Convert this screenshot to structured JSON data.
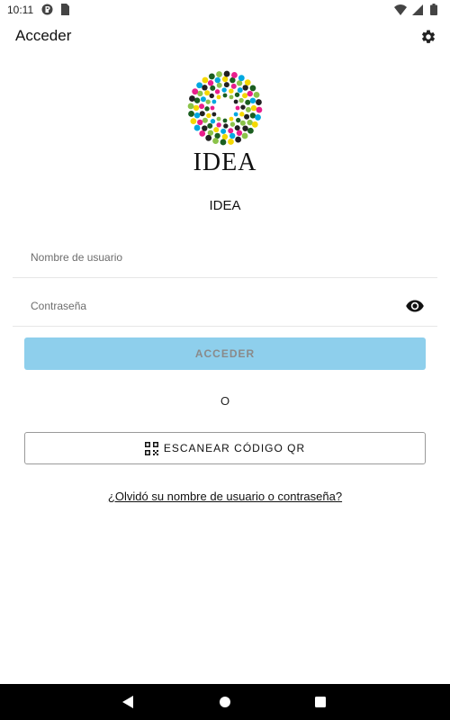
{
  "status_bar": {
    "time": "10:11",
    "icons": [
      "notification-icon",
      "sim-icon",
      "wifi-icon",
      "signal-icon",
      "battery-icon"
    ]
  },
  "app_bar": {
    "title": "Acceder",
    "settings_icon": "gear-icon"
  },
  "logo": {
    "wordmark": "IDEA",
    "colors": [
      "#e91e8c",
      "#00a8e0",
      "#f5d800",
      "#1b5e20",
      "#8bc34a",
      "#212121"
    ]
  },
  "app_name": "IDEA",
  "form": {
    "username_placeholder": "Nombre de usuario",
    "username_value": "",
    "password_placeholder": "Contraseña",
    "password_value": "",
    "password_toggle_icon": "eye-icon",
    "submit_label": "ACCEDER",
    "submit_color": "#8ecfec"
  },
  "divider_text": "O",
  "qr": {
    "label": "ESCANEAR CÓDIGO QR",
    "icon": "qr-code-icon"
  },
  "forgot_link": "¿Olvidó su nombre de usuario o contraseña?",
  "nav_bar": {
    "back_icon": "back-icon",
    "home_icon": "home-icon",
    "recent_icon": "recent-apps-icon"
  }
}
